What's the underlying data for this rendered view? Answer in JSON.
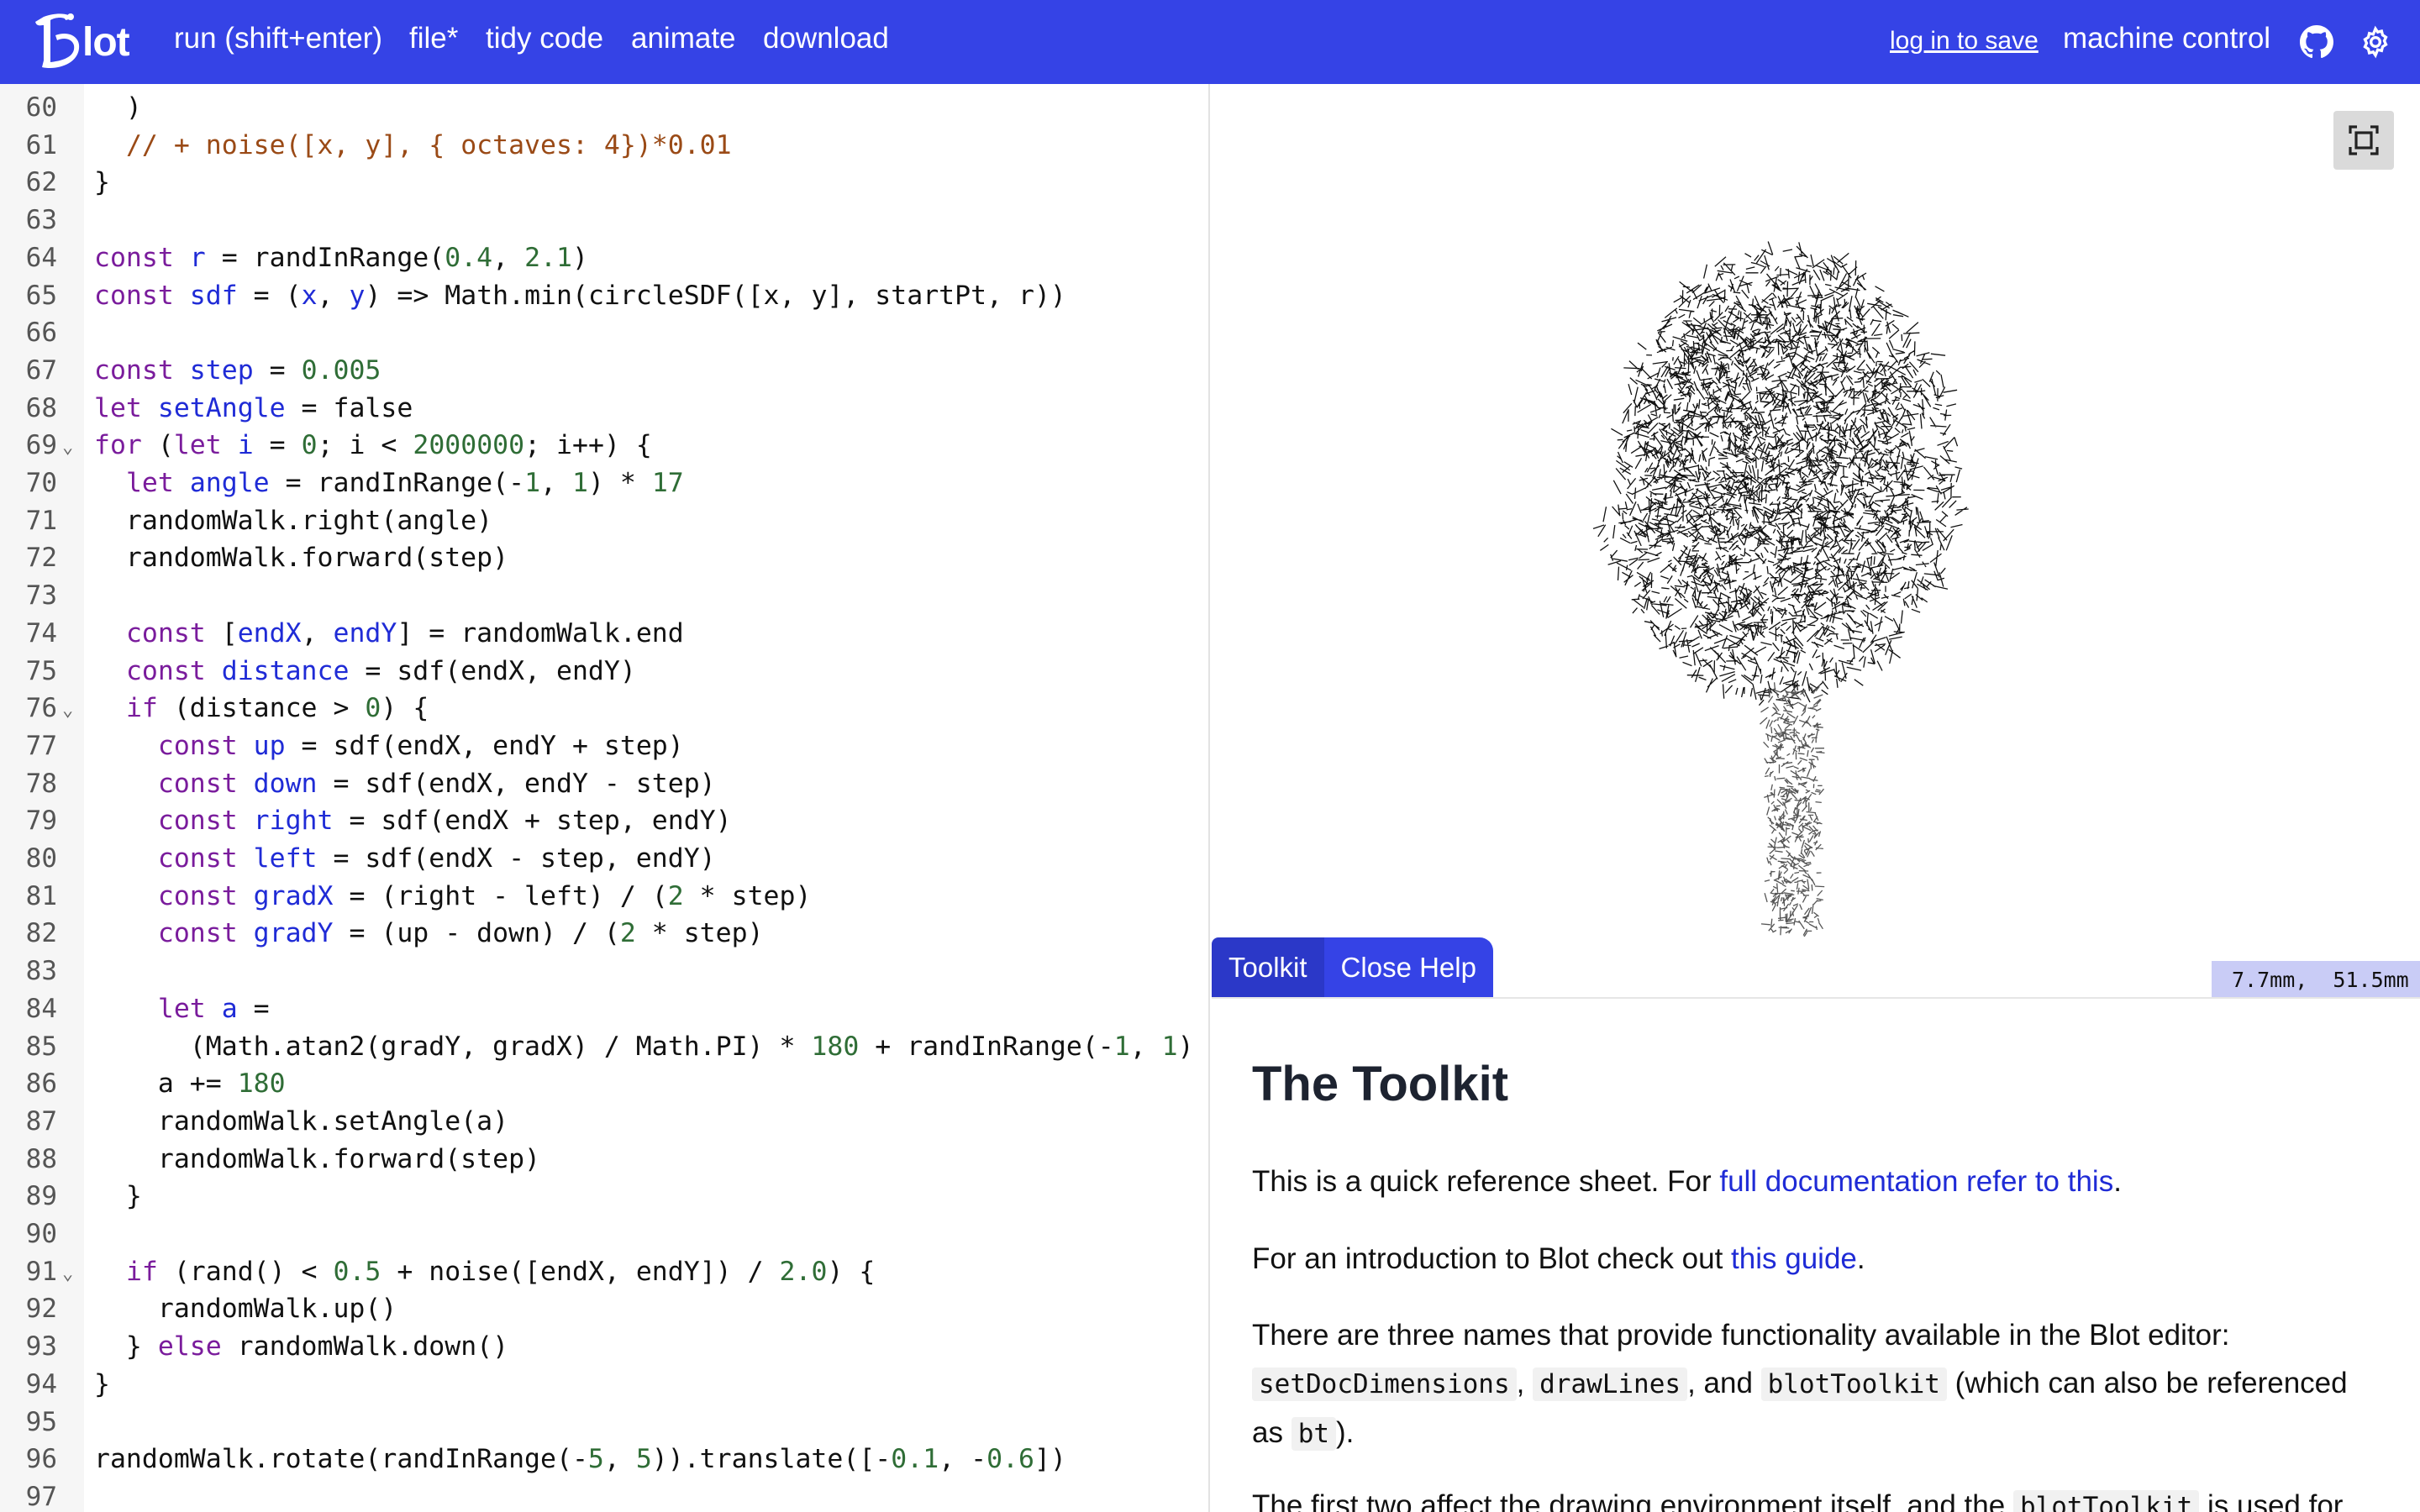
{
  "app": {
    "logo_text": "lot",
    "menu": {
      "run": "run (shift+enter)",
      "file": "file*",
      "tidy": "tidy code",
      "animate": "animate",
      "download": "download"
    },
    "login": "log in to save",
    "machine_control": "machine control",
    "icons": [
      "github-icon",
      "gear-icon"
    ],
    "accent_color": "#3543e6"
  },
  "editor": {
    "lines": [
      {
        "n": "60",
        "t": "  )"
      },
      {
        "n": "61",
        "t": "  // + noise([x, y], { octaves: 4})*0.01"
      },
      {
        "n": "62",
        "t": "}"
      },
      {
        "n": "63",
        "t": ""
      },
      {
        "n": "64",
        "t": "const r = randInRange(0.4, 2.1)"
      },
      {
        "n": "65",
        "t": "const sdf = (x, y) => Math.min(circleSDF([x, y], startPt, r))"
      },
      {
        "n": "66",
        "t": ""
      },
      {
        "n": "67",
        "t": "const step = 0.005"
      },
      {
        "n": "68",
        "t": "let setAngle = false"
      },
      {
        "n": "69",
        "t": "for (let i = 0; i < 2000000; i++) {",
        "fold": true
      },
      {
        "n": "70",
        "t": "  let angle = randInRange(-1, 1) * 17"
      },
      {
        "n": "71",
        "t": "  randomWalk.right(angle)"
      },
      {
        "n": "72",
        "t": "  randomWalk.forward(step)"
      },
      {
        "n": "73",
        "t": ""
      },
      {
        "n": "74",
        "t": "  const [endX, endY] = randomWalk.end"
      },
      {
        "n": "75",
        "t": "  const distance = sdf(endX, endY)"
      },
      {
        "n": "76",
        "t": "  if (distance > 0) {",
        "fold": true
      },
      {
        "n": "77",
        "t": "    const up = sdf(endX, endY + step)"
      },
      {
        "n": "78",
        "t": "    const down = sdf(endX, endY - step)"
      },
      {
        "n": "79",
        "t": "    const right = sdf(endX + step, endY)"
      },
      {
        "n": "80",
        "t": "    const left = sdf(endX - step, endY)"
      },
      {
        "n": "81",
        "t": "    const gradX = (right - left) / (2 * step)"
      },
      {
        "n": "82",
        "t": "    const gradY = (up - down) / (2 * step)"
      },
      {
        "n": "83",
        "t": ""
      },
      {
        "n": "84",
        "t": "    let a ="
      },
      {
        "n": "85",
        "t": "      (Math.atan2(gradY, gradX) / Math.PI) * 180 + randInRange(-1, 1)"
      },
      {
        "n": "86",
        "t": "    a += 180"
      },
      {
        "n": "87",
        "t": "    randomWalk.setAngle(a)"
      },
      {
        "n": "88",
        "t": "    randomWalk.forward(step)"
      },
      {
        "n": "89",
        "t": "  }"
      },
      {
        "n": "90",
        "t": ""
      },
      {
        "n": "91",
        "t": "  if (rand() < 0.5 + noise([endX, endY]) / 2.0) {",
        "fold": true
      },
      {
        "n": "92",
        "t": "    randomWalk.up()"
      },
      {
        "n": "93",
        "t": "  } else randomWalk.down()"
      },
      {
        "n": "94",
        "t": "}"
      },
      {
        "n": "95",
        "t": ""
      },
      {
        "n": "96",
        "t": "randomWalk.rotate(randInRange(-5, 5)).translate([-0.1, -0.6])"
      },
      {
        "n": "97",
        "t": ""
      }
    ]
  },
  "preview": {
    "fullscreen_icon": "fullscreen-icon",
    "coordinates": "7.7mm,  51.5mm"
  },
  "help": {
    "tabs": [
      "Toolkit",
      "Close Help"
    ],
    "title": "The Toolkit",
    "p1_pre": "This is a quick reference sheet. For ",
    "p1_link": "full documentation refer to this",
    "p1_post": ".",
    "p2_pre": "For an introduction to Blot check out ",
    "p2_link": "this guide",
    "p2_post": ".",
    "p3_a": "There are three names that provide functionality available in the Blot editor:",
    "p3_code1": "setDocDimensions",
    "p3_b": ", ",
    "p3_code2": "drawLines",
    "p3_c": ", and ",
    "p3_code3": "blotToolkit",
    "p3_d": " (which can also be referenced",
    "p3_e": "as ",
    "p3_code4": "bt",
    "p3_f": ").",
    "p4_a": "The first two affect the drawing environment itself, and the ",
    "p4_code": "blotToolkit",
    "p4_b": " is used for"
  }
}
